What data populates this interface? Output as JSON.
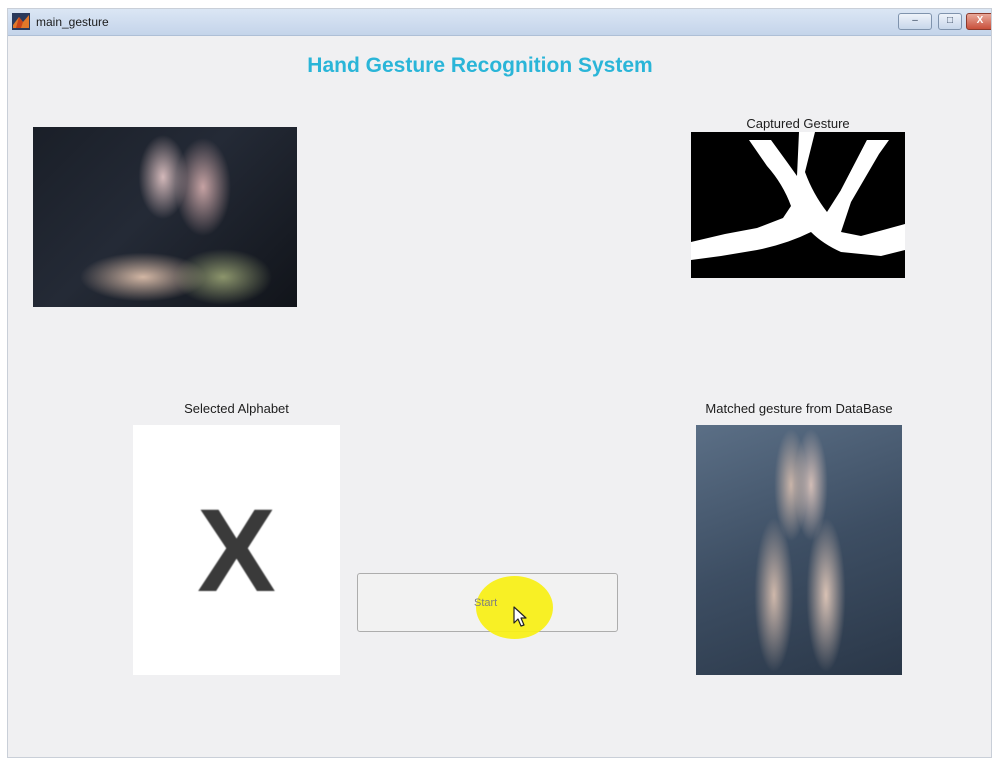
{
  "window": {
    "title": "main_gesture",
    "controls": {
      "minimize": "–",
      "maximize": "□",
      "close": "X"
    }
  },
  "header": {
    "title": "Hand Gesture Recognition System"
  },
  "panels": {
    "captured_label": "Captured Gesture",
    "selected_label": "Selected Alphabet",
    "selected_letter": "X",
    "matched_label": "Matched gesture from DataBase"
  },
  "controls": {
    "start_label": "Start"
  },
  "colors": {
    "title_accent": "#2ab5d8",
    "click_highlight": "#f8f014"
  }
}
